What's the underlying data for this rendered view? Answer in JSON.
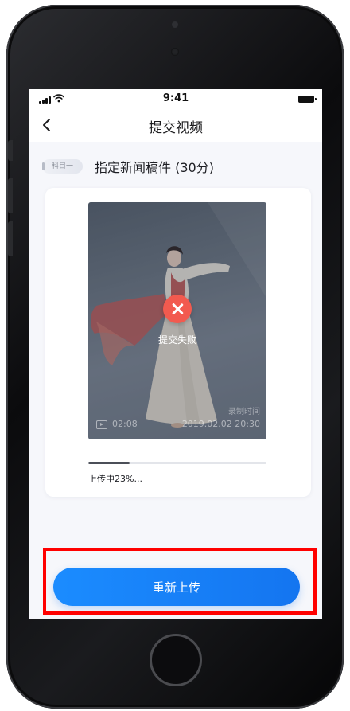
{
  "status_bar": {
    "time": "9:41"
  },
  "nav": {
    "title": "提交视频"
  },
  "question": {
    "subject_tag": "科目一",
    "title": "指定新闻稿件 (30分)"
  },
  "video": {
    "status": "提交失败",
    "record_label": "录制时间",
    "duration": "02:08",
    "record_time": "2019.02.02 20:30"
  },
  "upload": {
    "progress_percent": 23,
    "progress_text": "上传中23%..."
  },
  "action": {
    "retry_label": "重新上传"
  },
  "colors": {
    "accent": "#1b8cff",
    "error": "#f25a4f",
    "highlight": "#ff0000"
  }
}
